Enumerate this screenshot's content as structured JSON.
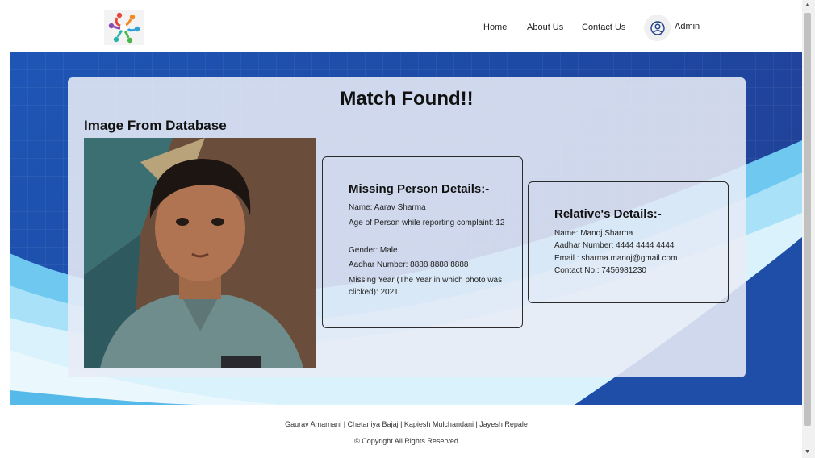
{
  "nav": {
    "home": "Home",
    "about": "About Us",
    "contact": "Contact Us",
    "admin": "Admin"
  },
  "card": {
    "title": "Match Found!!",
    "db_heading": "Image From Database"
  },
  "missing": {
    "heading": "Missing Person Details:-",
    "name": "Name: Aarav Sharma",
    "age": "Age of Person while reporting complaint: 12",
    "gender": "Gender: Male",
    "aadhar": "Aadhar Number: 8888 8888 8888",
    "missing_year": "Missing Year (The Year in which photo was clicked): 2021"
  },
  "relative": {
    "heading": "Relative's Details:-",
    "name": "Name: Manoj Sharma",
    "aadhar": "Aadhar Number: 4444 4444 4444",
    "email": "Email : sharma.manoj@gmail.com",
    "contact": "Contact No.: 7456981230"
  },
  "footer": {
    "names": "Gaurav Amarnani | Chetaniya Bajaj | Kapiesh Mulchandani | Jayesh Repale",
    "copyright": "© Copyright All Rights Reserved"
  },
  "colors": {
    "hero_blue": "#1f56b6",
    "wave_light": "#7fd3f5"
  }
}
